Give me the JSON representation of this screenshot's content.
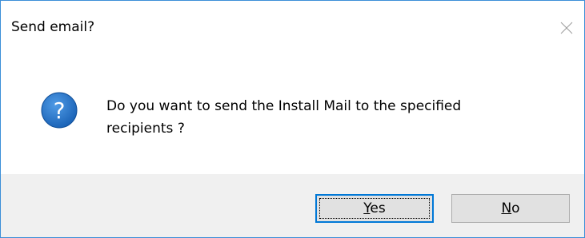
{
  "window": {
    "title": "Send email?",
    "close_icon": "close-icon",
    "border_color": "#3c8fd8"
  },
  "message": {
    "icon": "question-icon",
    "icon_color": "#1e6fc9",
    "text": "Do you want to send the Install Mail to the specified\nrecipients ?"
  },
  "buttons": {
    "yes": {
      "mnemonic": "Y",
      "rest": "es",
      "default": true
    },
    "no": {
      "mnemonic": "N",
      "rest": "o"
    }
  },
  "colors": {
    "footer_bg": "#f0f0f0",
    "button_bg": "#e1e1e1",
    "focus_border": "#0078d7"
  }
}
